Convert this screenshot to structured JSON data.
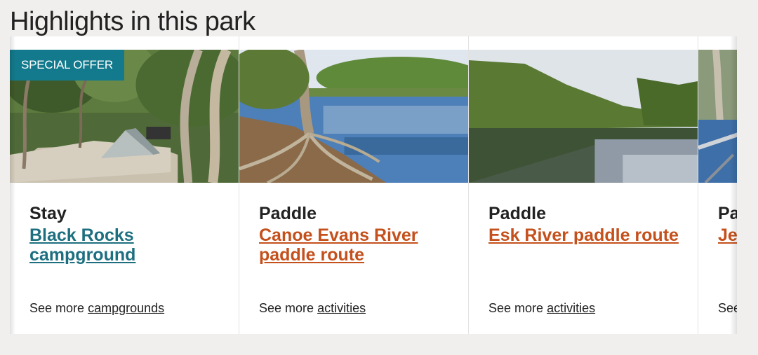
{
  "section": {
    "heading": "Highlights in this park"
  },
  "cards": [
    {
      "badge": "SPECIAL OFFER",
      "category": "Stay",
      "title": "Black Rocks campground",
      "title_color": "#1d6f80",
      "see_more_prefix": "See more",
      "see_more_link": "campgrounds"
    },
    {
      "category": "Paddle",
      "title": "Canoe Evans River paddle route",
      "title_color": "#c4501c",
      "see_more_prefix": "See more",
      "see_more_link": "activities"
    },
    {
      "category": "Paddle",
      "title": "Esk River paddle route",
      "title_color": "#c4501c",
      "see_more_prefix": "See more",
      "see_more_link": "activities"
    },
    {
      "category": "Pa",
      "title": "Je pa",
      "title_color": "#c4501c",
      "see_more_prefix": "See",
      "see_more_link": ""
    }
  ],
  "colors": {
    "badge_bg": "#127a8c",
    "page_bg": "#f0efed"
  }
}
